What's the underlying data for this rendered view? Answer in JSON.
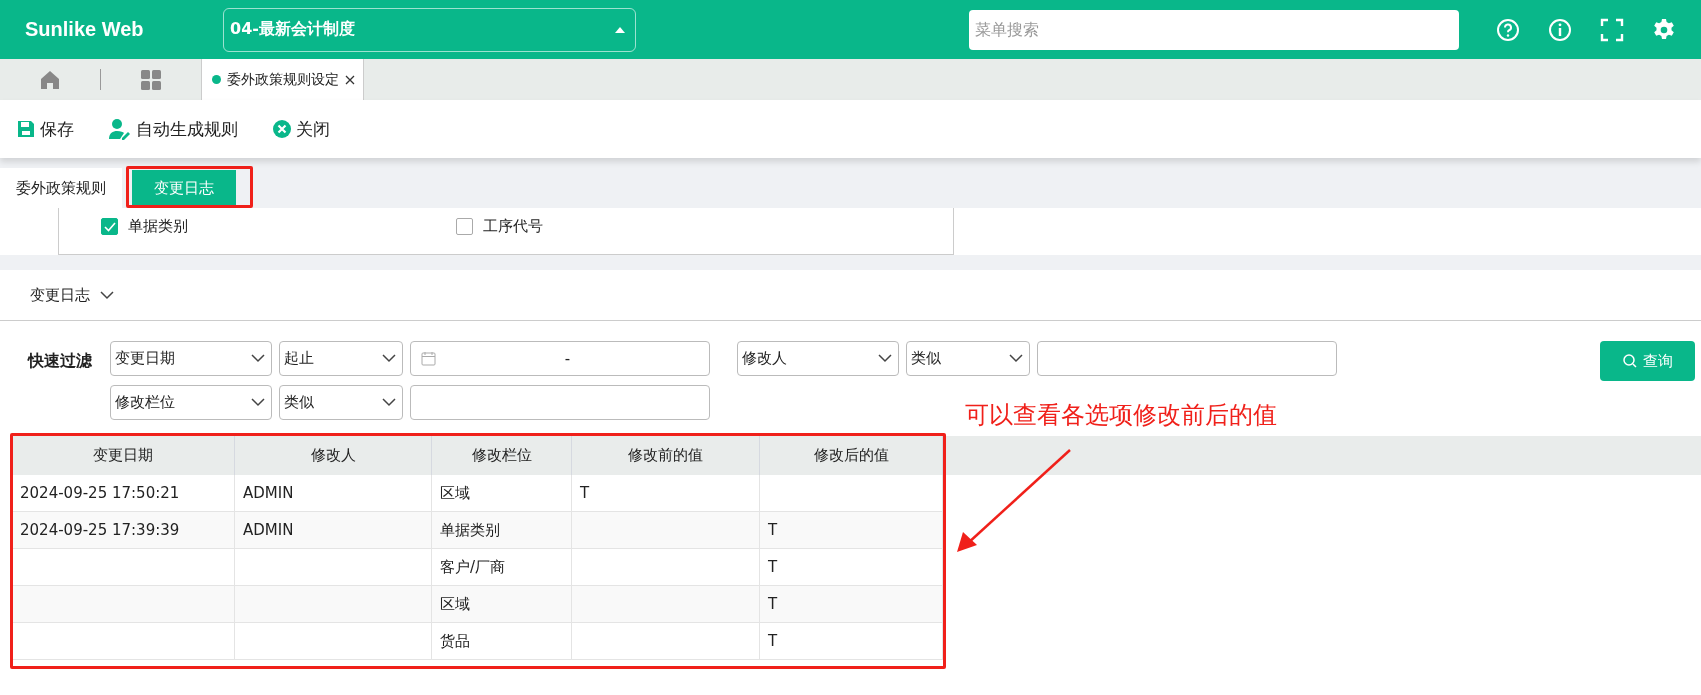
{
  "header": {
    "logo": "Sunlike Web",
    "company_select": {
      "value": "04-最新会计制度"
    },
    "search": {
      "placeholder": "菜单搜索"
    }
  },
  "page_tabs": [
    {
      "label": "委外政策规则设定",
      "selected": true
    }
  ],
  "toolbar": [
    {
      "kind": "save",
      "label": "保存"
    },
    {
      "kind": "auto",
      "label": "自动生成规则"
    },
    {
      "kind": "close",
      "label": "关闭"
    }
  ],
  "tabs": [
    {
      "label": "委外政策规则",
      "selected": false
    },
    {
      "label": "变更日志",
      "selected": true
    }
  ],
  "options": [
    {
      "label": "单据类别",
      "checked": true
    },
    {
      "label": "工序代号",
      "checked": false
    }
  ],
  "log_section": {
    "title": "变更日志",
    "expanded": true
  },
  "quick_filter": {
    "label": "快速过滤",
    "filters": [
      {
        "field": "变更日期",
        "operator": "起止",
        "kind": "date-range",
        "separator": "-"
      },
      {
        "field": "修改人",
        "operator": "类似",
        "kind": "text"
      },
      {
        "field": "修改栏位",
        "operator": "类似",
        "kind": "text"
      }
    ],
    "query_button": "查询"
  },
  "table": {
    "columns": [
      "变更日期",
      "修改人",
      "修改栏位",
      "修改前的值",
      "修改后的值"
    ],
    "rows": [
      [
        "2024-09-25 17:50:21",
        "ADMIN",
        "区域",
        "T",
        ""
      ],
      [
        "2024-09-25 17:39:39",
        "ADMIN",
        "单据类别",
        "",
        "T"
      ],
      [
        "",
        "",
        "客户/厂商",
        "",
        "T"
      ],
      [
        "",
        "",
        "区域",
        "",
        "T"
      ],
      [
        "",
        "",
        "货品",
        "",
        "T"
      ]
    ]
  },
  "annotation": {
    "text": "可以查看各选项修改前后的值"
  }
}
